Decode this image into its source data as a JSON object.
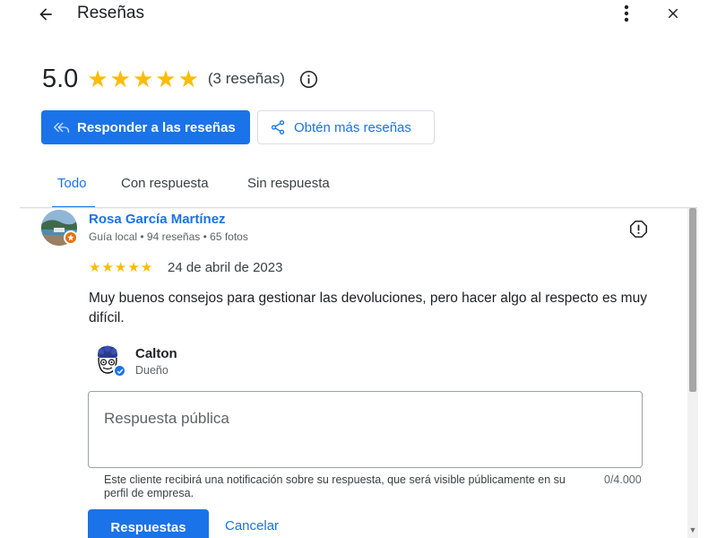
{
  "header": {
    "title": "Reseñas",
    "back_icon": "arrow-left-icon",
    "more_icon": "more-vert-icon",
    "close_icon": "close-icon"
  },
  "summary": {
    "rating": "5.0",
    "stars": 5,
    "count_label": "(3 reseñas)",
    "star_color": "#fbbc04"
  },
  "actions": {
    "respond_label": "Responder a las reseñas",
    "get_more_label": "Obtén más reseñas"
  },
  "tabs": [
    {
      "label": "Todo",
      "active": true
    },
    {
      "label": "Con respuesta",
      "active": false
    },
    {
      "label": "Sin respuesta",
      "active": false
    }
  ],
  "review": {
    "reviewer_name": "Rosa García Martínez",
    "reviewer_meta": "Guía local • 94 reseñas • 65 fotos",
    "stars": 5,
    "date": "24 de abril de 2023",
    "text": "Muy buenos consejos para gestionar las devoluciones, pero hacer algo al respecto es muy difícil."
  },
  "owner": {
    "name": "Calton",
    "role": "Dueño"
  },
  "reply": {
    "placeholder": "Respuesta pública",
    "note": "Este cliente recibirá una notificación sobre su respuesta, que será visible públicamente en su perfil de empresa.",
    "char_count": "0/4.000",
    "submit_label": "Respuestas",
    "cancel_label": "Cancelar"
  },
  "colors": {
    "accent": "#1a73e8",
    "badge_orange": "#e8710a"
  }
}
